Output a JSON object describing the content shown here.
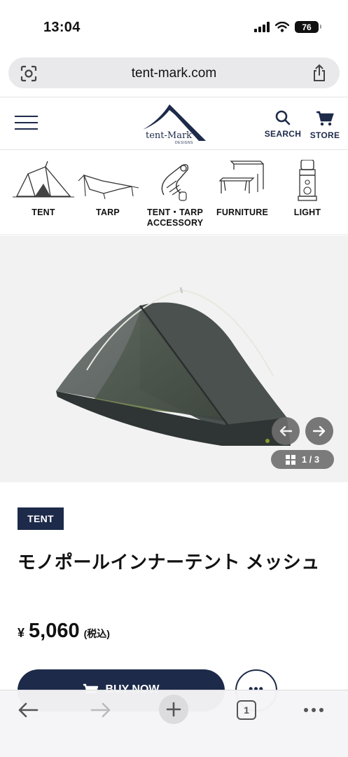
{
  "status_bar": {
    "time": "13:04",
    "battery": "76"
  },
  "browser": {
    "url": "tent-mark.com",
    "tab_count": "1"
  },
  "header": {
    "logo_text": "tent-Mark",
    "logo_subtext": "DESIGNS",
    "search_label": "SEARCH",
    "store_label": "STORE"
  },
  "categories": [
    {
      "label": "TENT",
      "icon": "tent-icon"
    },
    {
      "label": "TARP",
      "icon": "tarp-icon"
    },
    {
      "label": "TENT・TARP\nACCESSORY",
      "icon": "accessory-icon"
    },
    {
      "label": "FURNITURE",
      "icon": "furniture-icon"
    },
    {
      "label": "LIGHT",
      "icon": "lantern-icon"
    }
  ],
  "gallery": {
    "counter": "1 / 3"
  },
  "product": {
    "category": "TENT",
    "title": "モノポールインナーテント メッシュ",
    "price_symbol": "¥",
    "price": "5,060",
    "tax_note": "(税込)",
    "buy_label": "BUY NOW",
    "more_label": "•••"
  },
  "colors": {
    "navy": "#1d2a4a",
    "gallery_bg": "#f2f2f2"
  }
}
